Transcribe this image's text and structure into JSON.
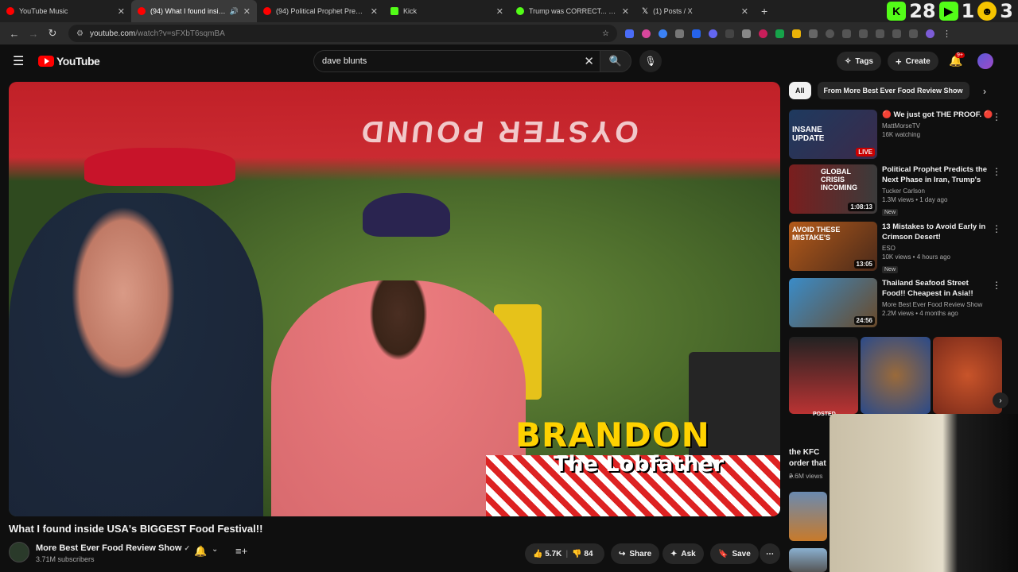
{
  "browser": {
    "tabs": [
      {
        "title": "YouTube Music",
        "fav": "#ff0000"
      },
      {
        "title": "(94) What I found inside USA",
        "fav": "#ff0000"
      },
      {
        "title": "(94) Political Prophet Predicts th",
        "fav": "#ff0000"
      },
      {
        "title": "Kick",
        "fav": "#53fc18"
      },
      {
        "title": "Trump was CORRECT... the E",
        "fav": "#53fc18"
      },
      {
        "title": "(1) Posts / X",
        "fav": "#ffffff"
      }
    ],
    "score": {
      "k_val": "28",
      "play_val": "1",
      "last_val": "3"
    },
    "url_main": "youtube.com",
    "url_rest": "/watch?v=sFXbT6sqmBA"
  },
  "yt": {
    "logo_text": "YouTube",
    "search_value": "dave blunts",
    "tags_label": "Tags",
    "create_label": "Create",
    "notif_count": "9+"
  },
  "video": {
    "canopy_text": "OYSTER POUND",
    "overlay_name": "BRANDON",
    "overlay_sub": "The Lobfather",
    "title": "What I found inside USA's BIGGEST Food Festival!!",
    "channel": "More Best Ever Food Review Show",
    "subscribers": "3.71M subscribers",
    "likes": "5.7K",
    "dislikes": "84",
    "share_label": "Share",
    "ask_label": "Ask",
    "save_label": "Save"
  },
  "chips": [
    "All",
    "From More Best Ever Food Review Show"
  ],
  "recs": [
    {
      "title": "🔴 We just got THE PROOF. 🔴",
      "channel": "MattMorseTV",
      "meta": "16K watching",
      "badge": "LIVE",
      "thumb_text": "INSANE UPDATE",
      "new": ""
    },
    {
      "title": "Political Prophet Predicts the Next Phase in Iran, Trump's W...",
      "channel": "Tucker Carlson",
      "meta": "1.3M views • 1 day ago",
      "badge": "1:08:13",
      "thumb_text": "GLOBAL CRISIS INCOMING",
      "new": "New"
    },
    {
      "title": "13 Mistakes to Avoid Early in Crimson Desert!",
      "channel": "ESO",
      "meta": "10K views • 4 hours ago",
      "badge": "13:05",
      "thumb_text": "AVOID THESE MISTAKE'S",
      "new": "New"
    },
    {
      "title": "Thailand Seafood Street Food!! Cheapest in Asia!!",
      "channel": "More Best Ever Food Review Show",
      "meta": "2.2M views • 4 months ago",
      "badge": "24:56",
      "thumb_text": "",
      "new": ""
    }
  ],
  "shorts": {
    "posted": "POSTED",
    "title": "the KFC order that ..",
    "views": "2.6M views"
  }
}
